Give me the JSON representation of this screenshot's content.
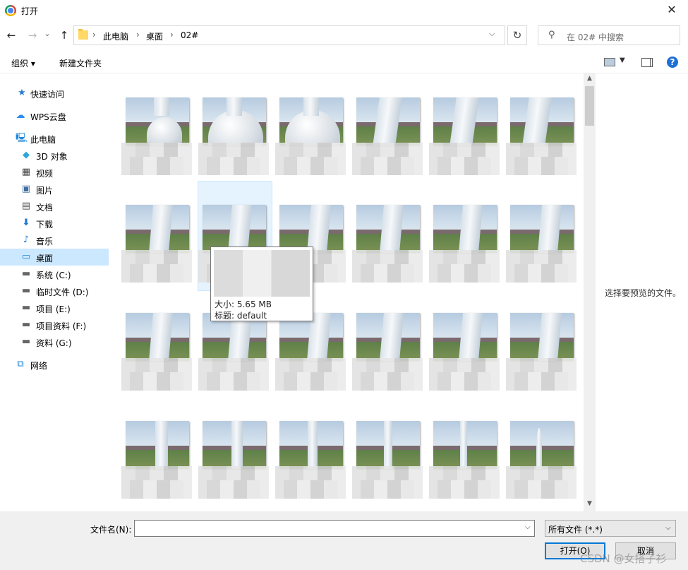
{
  "window": {
    "title": "打开",
    "close_glyph": "✕"
  },
  "nav": {
    "back_glyph": "←",
    "forward_glyph": "→",
    "recent_glyph": "⌄",
    "up_glyph": "↑",
    "breadcrumb": [
      "此电脑",
      "桌面",
      "02#"
    ],
    "separator": "›",
    "refresh_glyph": "↻",
    "search_placeholder": "在 02# 中搜索"
  },
  "toolbar": {
    "organize": "组织 ▾",
    "new_folder": "新建文件夹",
    "help": "?"
  },
  "sidebar": {
    "items": [
      {
        "label": "快速访问",
        "icon": "star-icon"
      },
      {
        "label": "WPS云盘",
        "icon": "cloud-icon"
      },
      {
        "label": "此电脑",
        "icon": "computer-icon"
      },
      {
        "label": "3D 对象",
        "icon": "cube-icon"
      },
      {
        "label": "视频",
        "icon": "video-icon"
      },
      {
        "label": "图片",
        "icon": "picture-icon"
      },
      {
        "label": "文档",
        "icon": "document-icon"
      },
      {
        "label": "下载",
        "icon": "download-icon"
      },
      {
        "label": "音乐",
        "icon": "music-icon"
      },
      {
        "label": "桌面",
        "icon": "desktop-icon",
        "selected": true
      },
      {
        "label": "系统 (C:)",
        "icon": "drive-icon"
      },
      {
        "label": "临时文件 (D:)",
        "icon": "drive-icon"
      },
      {
        "label": "项目 (E:)",
        "icon": "drive-icon"
      },
      {
        "label": "项目资料 (F:)",
        "icon": "drive-icon"
      },
      {
        "label": "资料 (G:)",
        "icon": "drive-icon"
      },
      {
        "label": "网络",
        "icon": "network-icon"
      }
    ]
  },
  "tooltip": {
    "size": "大小: 5.65 MB",
    "title": "标题: default"
  },
  "preview": {
    "message": "选择要预览的文件。"
  },
  "bottom": {
    "filename_label": "文件名(N):",
    "filename_value": "",
    "filetype_value": "所有文件 (*.*)",
    "open_label": "打开(O)",
    "cancel_label": "取消"
  },
  "watermark": "CSDN @女搭子衫"
}
